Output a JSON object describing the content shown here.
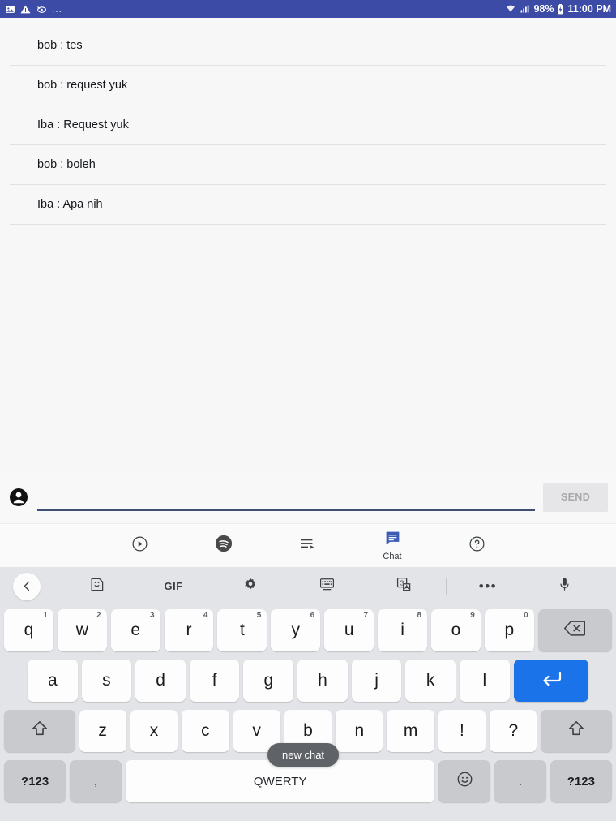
{
  "status_bar": {
    "background": "#3c4ba6",
    "left_icons": [
      "image-icon",
      "warning-icon",
      "debug-eye-icon"
    ],
    "overflow": "...",
    "wifi_icon": "wifi-icon",
    "signal_icon": "signal-icon",
    "battery_percent": "98%",
    "battery_icon": "battery-icon",
    "time": "11:00 PM"
  },
  "chat": {
    "messages": [
      {
        "text": "bob : tes"
      },
      {
        "text": "bob : request yuk"
      },
      {
        "text": "Iba : Request yuk"
      },
      {
        "text": "bob : boleh"
      },
      {
        "text": "Iba : Apa nih"
      }
    ]
  },
  "compose": {
    "avatar_icon": "account-circle-icon",
    "input_value": "",
    "input_placeholder": "",
    "send_label": "SEND",
    "send_enabled": false
  },
  "bottom_nav": {
    "active_color": "#3b5bb5",
    "items": [
      {
        "icon": "play-circle-icon",
        "label": "",
        "active": false
      },
      {
        "icon": "spotify-icon",
        "label": "",
        "active": false
      },
      {
        "icon": "queue-playlist-icon",
        "label": "",
        "active": false
      },
      {
        "icon": "chat-bubble-icon",
        "label": "Chat",
        "active": true
      },
      {
        "icon": "help-circle-icon",
        "label": "",
        "active": false
      }
    ]
  },
  "keyboard": {
    "toolbar": [
      {
        "icon": "back-chevron-icon"
      },
      {
        "icon": "sticker-icon"
      },
      {
        "icon": "gif-icon",
        "label": "GIF"
      },
      {
        "icon": "gear-icon"
      },
      {
        "icon": "keyboard-resize-icon"
      },
      {
        "icon": "translate-lens-icon"
      },
      {
        "icon": "divider"
      },
      {
        "icon": "more-horizontal-icon",
        "label": "•••"
      },
      {
        "icon": "microphone-icon"
      }
    ],
    "row1": [
      {
        "key": "q",
        "sup": "1"
      },
      {
        "key": "w",
        "sup": "2"
      },
      {
        "key": "e",
        "sup": "3"
      },
      {
        "key": "r",
        "sup": "4"
      },
      {
        "key": "t",
        "sup": "5"
      },
      {
        "key": "y",
        "sup": "6"
      },
      {
        "key": "u",
        "sup": "7"
      },
      {
        "key": "i",
        "sup": "8"
      },
      {
        "key": "o",
        "sup": "9"
      },
      {
        "key": "p",
        "sup": "0"
      }
    ],
    "backspace_icon": "backspace-icon",
    "row2": [
      "a",
      "s",
      "d",
      "f",
      "g",
      "h",
      "j",
      "k",
      "l"
    ],
    "enter_icon": "enter-return-icon",
    "enter_color": "#1a73e8",
    "shift_icon": "shift-icon",
    "row3": [
      "z",
      "x",
      "c",
      "v",
      "b",
      "n",
      "m",
      "!",
      "?"
    ],
    "row4": {
      "symbols_left": "?123",
      "comma": ",",
      "space_label": "QWERTY",
      "emoji_icon": "emoji-smiley-icon",
      "period": ".",
      "symbols_right": "?123"
    }
  },
  "tooltip": {
    "text": "new chat"
  }
}
